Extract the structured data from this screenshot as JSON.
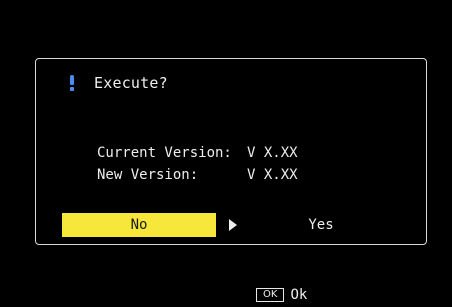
{
  "dialog": {
    "title": "Execute?",
    "icon": "exclamation-icon",
    "icon_color": "#4c8cf0",
    "current_version_label": "Current Version:",
    "current_version_value": "V X.XX",
    "new_version_label": "New Version:",
    "new_version_value": "V X.XX",
    "no_label": "No",
    "yes_label": "Yes",
    "selected_option": "No",
    "highlight_color": "#f6e73a"
  },
  "footer": {
    "key_label": "OK",
    "action_label": "Ok"
  }
}
